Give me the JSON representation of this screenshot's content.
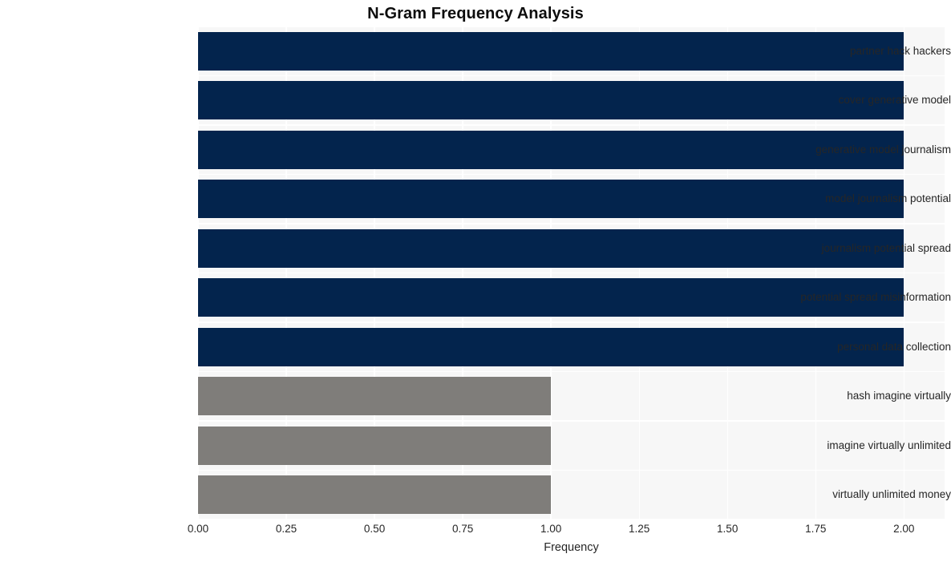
{
  "chart_data": {
    "type": "bar",
    "orientation": "horizontal",
    "title": "N-Gram Frequency Analysis",
    "xlabel": "Frequency",
    "ylabel": "",
    "grid": true,
    "legend": null,
    "xlim": [
      0,
      2.1153
    ],
    "xticks": [
      0,
      0.25,
      0.5,
      0.75,
      1,
      1.25,
      1.5,
      1.75,
      2
    ],
    "xticklabels": [
      "0.00",
      "0.25",
      "0.50",
      "0.75",
      "1.00",
      "1.25",
      "1.50",
      "1.75",
      "2.00"
    ],
    "categories": [
      "partner hack hackers",
      "cover generative model",
      "generative model journalism",
      "model journalism potential",
      "journalism potential spread",
      "potential spread misinformation",
      "personal data collection",
      "hash imagine virtually",
      "imagine virtually unlimited",
      "virtually unlimited money"
    ],
    "values": [
      2,
      2,
      2,
      2,
      2,
      2,
      2,
      1,
      1,
      1
    ],
    "bar_colors": [
      "#03244d",
      "#03244d",
      "#03244d",
      "#03244d",
      "#03244d",
      "#03244d",
      "#03244d",
      "#7f7d7a",
      "#7f7d7a",
      "#7f7d7a"
    ],
    "palette": {
      "high_frequency": "#03244d",
      "low_frequency": "#7f7d7a",
      "plot_background": "#f7f7f7",
      "figure_background": "#ffffff",
      "gridline": "#ffffff",
      "text": "#262626",
      "title_text": "#0d0d0d"
    }
  }
}
